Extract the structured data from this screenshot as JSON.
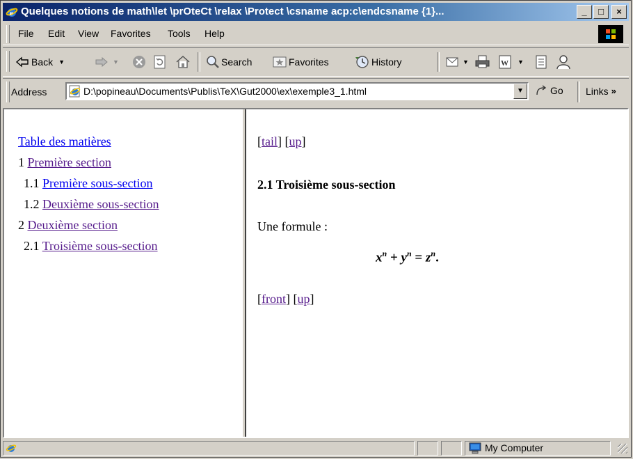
{
  "window": {
    "title": "Quelques notions de math\\let \\prOteCt \\relax \\Protect \\csname acp:c\\endcsname {1}...",
    "minimize_label": "_",
    "maximize_label": "□",
    "close_label": "×"
  },
  "menu": [
    "File",
    "Edit",
    "View",
    "Favorites",
    "Tools",
    "Help"
  ],
  "toolbar": {
    "back_label": "Back",
    "search_label": "Search",
    "favorites_label": "Favorites",
    "history_label": "History"
  },
  "address": {
    "label": "Address",
    "value": "D:\\popineau\\Documents\\Publis\\TeX\\Gut2000\\ex\\exemple3_1.html",
    "go_label": "Go",
    "links_label": "Links"
  },
  "toc": {
    "title": "Table des matières",
    "items": [
      {
        "number": "1",
        "label": "Première section",
        "visited": true
      },
      {
        "number": "1.1",
        "label": "Première sous-section",
        "visited": false
      },
      {
        "number": "1.2",
        "label": "Deuxième sous-section",
        "visited": true
      },
      {
        "number": "2",
        "label": "Deuxième section",
        "visited": true
      },
      {
        "number": "2.1",
        "label": "Troisième sous-section",
        "visited": true
      }
    ]
  },
  "page": {
    "nav_top": {
      "tail": "tail",
      "up": "up"
    },
    "heading": "2.1 Troisième sous-section",
    "intro": "Une formule :",
    "formula": {
      "x": "x",
      "y": "y",
      "z": "z",
      "exp": "n",
      "plus": "+",
      "eq": "=",
      "end": "."
    },
    "nav_bottom": {
      "front": "front",
      "up": "up"
    }
  },
  "status": {
    "zone": "My Computer"
  },
  "colors": {
    "link": "#0000ee",
    "visited": "#551a8b",
    "title_start": "#0a246a",
    "title_end": "#a6caf0"
  }
}
